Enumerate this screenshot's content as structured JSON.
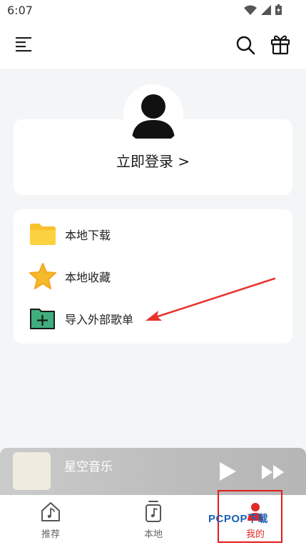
{
  "status_bar": {
    "time": "6:07"
  },
  "header": {
    "menu_icon": "menu-lines-icon",
    "search_icon": "search-icon",
    "gift_icon": "gift-icon"
  },
  "profile": {
    "login_label": "立即登录 >"
  },
  "menu": {
    "items": [
      {
        "label": "本地下载",
        "icon": "folder-icon"
      },
      {
        "label": "本地收藏",
        "icon": "star-icon"
      },
      {
        "label": "导入外部歌单",
        "icon": "folder-plus-icon"
      }
    ]
  },
  "player": {
    "song_title": "星空音乐"
  },
  "tabs": [
    {
      "label": "推荐",
      "icon": "home-icon"
    },
    {
      "label": "本地",
      "icon": "music-note-icon"
    },
    {
      "label": "我的",
      "icon": "person-icon",
      "active": true
    }
  ],
  "watermark": {
    "brand": "PCPOP",
    "suffix": "下载"
  },
  "colors": {
    "accent": "#e02a2a",
    "folder": "#f8c02a",
    "star": "#f5b92a",
    "import_folder": "#3fae7c"
  }
}
